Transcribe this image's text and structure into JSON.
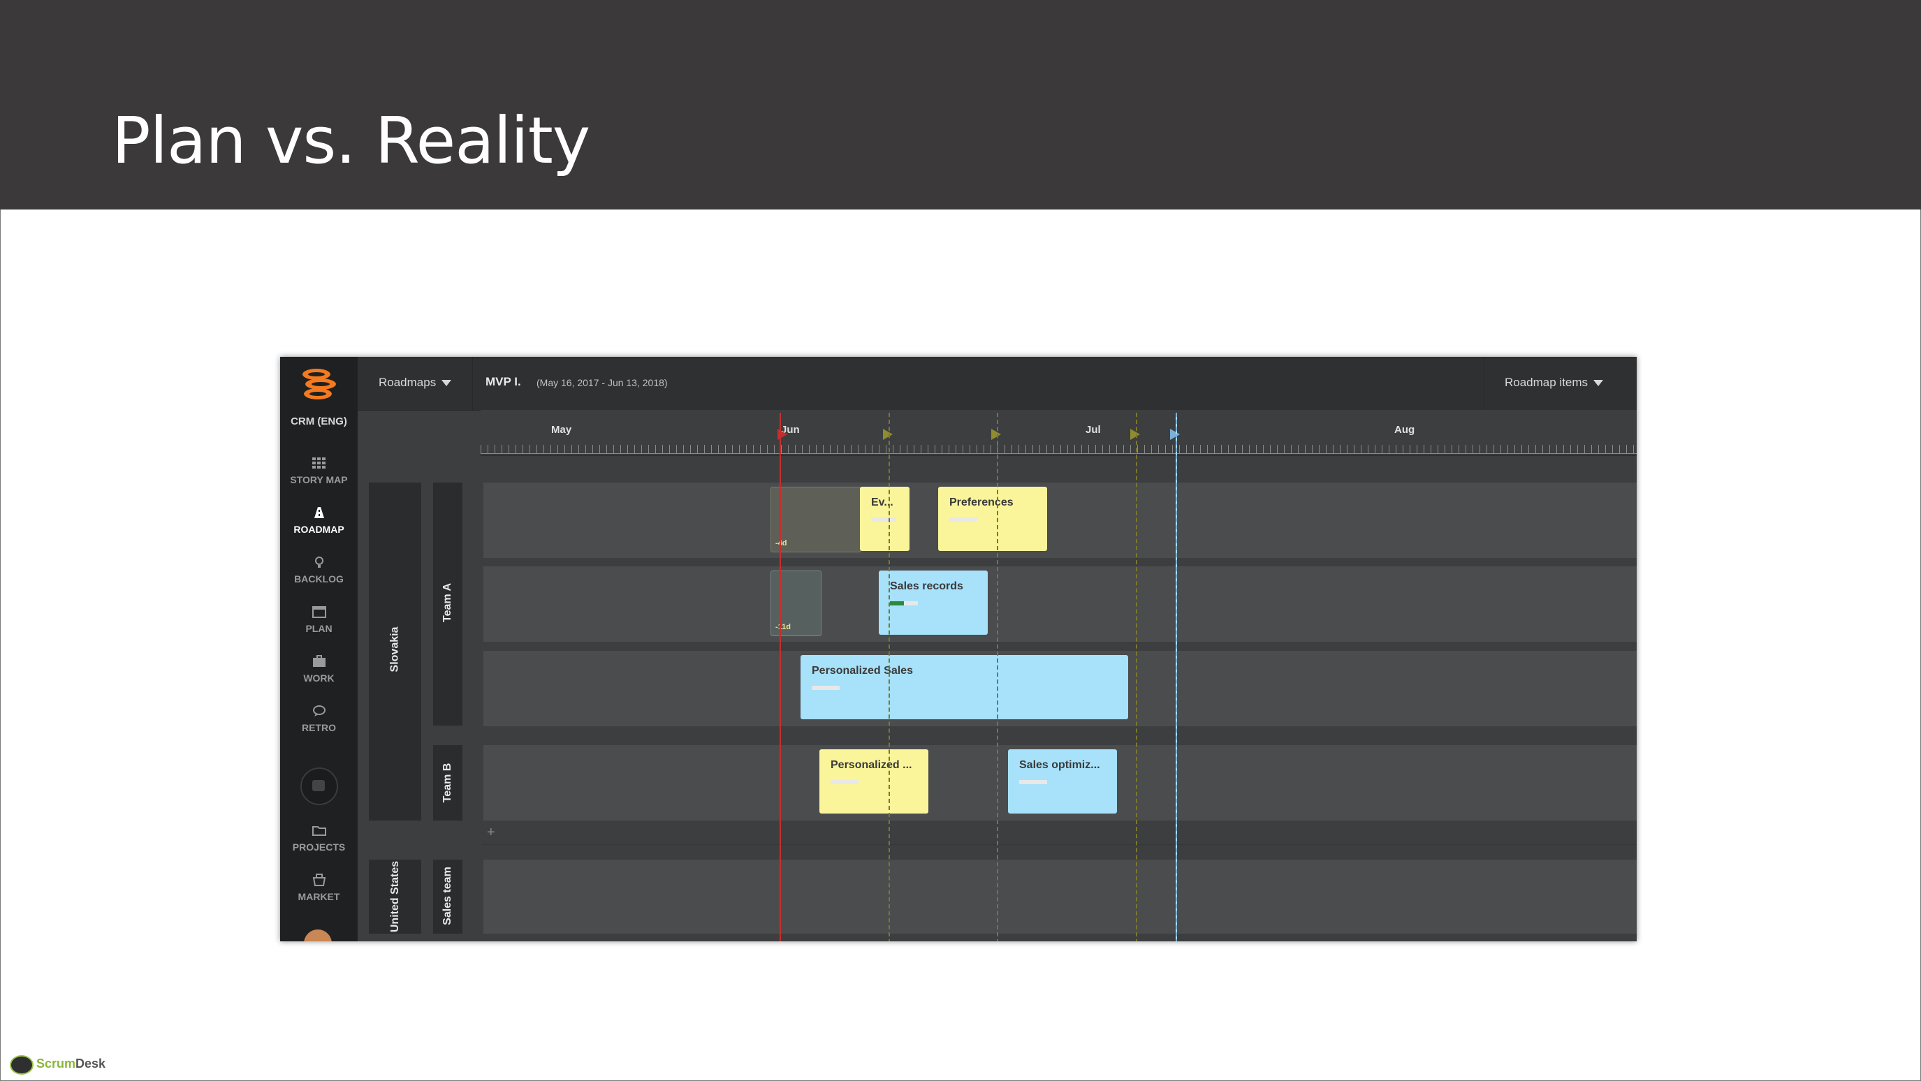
{
  "slide": {
    "title": "Plan vs. Reality"
  },
  "app": {
    "sidebar": {
      "project_name": "CRM (ENG)",
      "items": [
        {
          "label": "STORY MAP",
          "icon": "grid-icon"
        },
        {
          "label": "ROADMAP",
          "icon": "roadmap-icon",
          "active": true
        },
        {
          "label": "BACKLOG",
          "icon": "bulb-icon"
        },
        {
          "label": "PLAN",
          "icon": "calendar-icon"
        },
        {
          "label": "WORK",
          "icon": "briefcase-icon"
        },
        {
          "label": "RETRO",
          "icon": "chat-icon"
        },
        {
          "label": "PROJECTS",
          "icon": "folder-icon"
        },
        {
          "label": "MARKET",
          "icon": "basket-icon"
        }
      ]
    },
    "topbar": {
      "roadmaps_label": "Roadmaps",
      "mvp_title": "MVP I.",
      "mvp_range": "(May 16, 2017 - Jun 13, 2018)",
      "items_label": "Roadmap items"
    },
    "timeline": {
      "months": [
        "May",
        "Jun",
        "Jul",
        "Aug"
      ]
    },
    "groups": {
      "slovakia": "Slovakia",
      "united_states": "United States"
    },
    "teams": {
      "team_a": "Team A",
      "team_b": "Team B",
      "sales_team": "Sales team"
    },
    "cards": {
      "ev": "Ev...",
      "preferences": "Preferences",
      "sales_records": "Sales records",
      "personalized_sales": "Personalized Sales",
      "personalized_short": "Personalized ...",
      "sales_optimiz": "Sales optimiz...",
      "delta1": "-4d",
      "delta2": "-11d"
    },
    "colors": {
      "yellow": "#faf59a",
      "blue": "#a7e1fa",
      "today": "#c2302d",
      "accent": "#f47a20"
    }
  },
  "brand": {
    "name_a": "Scrum",
    "name_b": "Desk"
  }
}
